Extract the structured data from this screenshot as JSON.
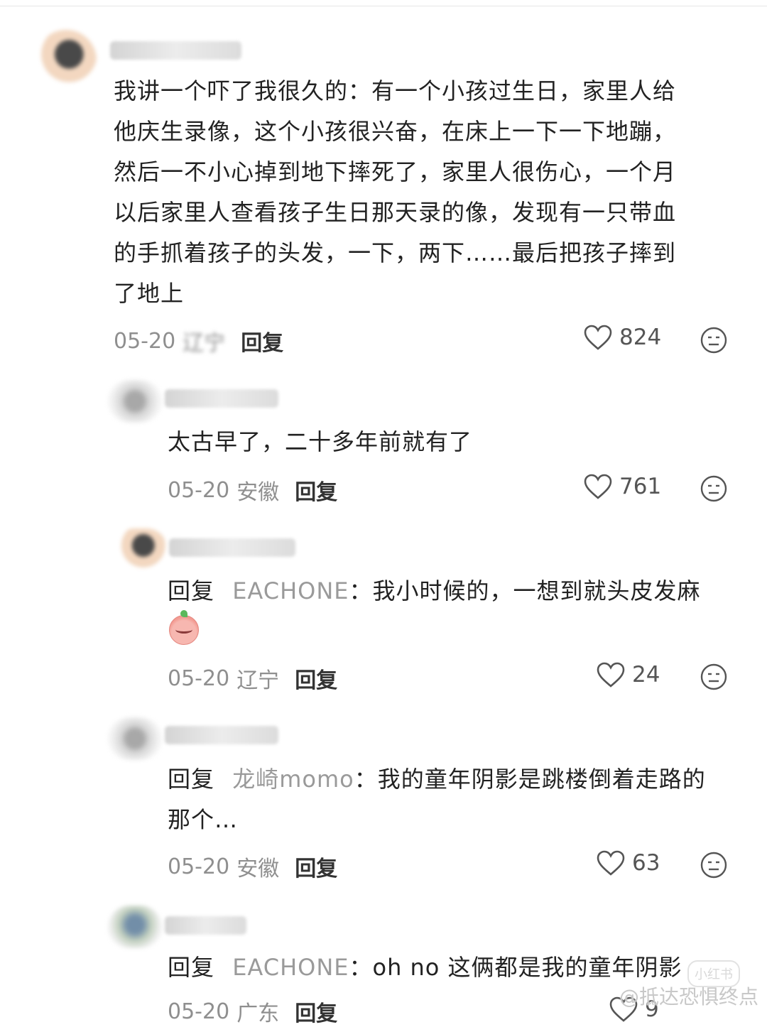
{
  "comments": [
    {
      "text_lines": [
        "我讲一个吓了我很久的：有一个小孩过生日，家里人给",
        "他庆生录像，这个小孩很兴奋，在床上一下一下地蹦，",
        "然后一不小心掉到地下摔死了，家里人很伤心，一个月",
        "以后家里人查看孩子生日那天录的像，发现有一只带血",
        "的手抓着孩子的头发，一下，两下……最后把孩子摔到",
        "了地上"
      ],
      "date": "05-20",
      "location": "辽宁",
      "reply_label": "回复",
      "likes": "824"
    },
    {
      "text_lines": [
        "太古早了，二十多年前就有了"
      ],
      "date": "05-20",
      "location": "安徽",
      "reply_label": "回复",
      "likes": "761"
    },
    {
      "reply_prefix": "回复",
      "mention": "EACHONE",
      "text_first": "：我小时候的，一想到就头皮发麻",
      "date": "05-20",
      "location": "辽宁",
      "reply_label": "回复",
      "likes": "24"
    },
    {
      "reply_prefix": "回复",
      "mention": "龙崎momo",
      "text_first": "：我的童年阴影是跳楼倒着走路的",
      "text_second": "那个…",
      "date": "05-20",
      "location": "安徽",
      "reply_label": "回复",
      "likes": "63"
    },
    {
      "reply_prefix": "回复",
      "mention": "EACHONE",
      "text_first": "：oh no 这俩都是我的童年阴影",
      "date": "05-20",
      "location": "广东",
      "reply_label": "回复",
      "likes": "9"
    }
  ],
  "watermark": "@抵达恐惧终点",
  "watermark_badge": "小红书",
  "colors": {
    "text": "#222222",
    "meta": "#8f8f8f",
    "mention": "#9a9a9a"
  }
}
